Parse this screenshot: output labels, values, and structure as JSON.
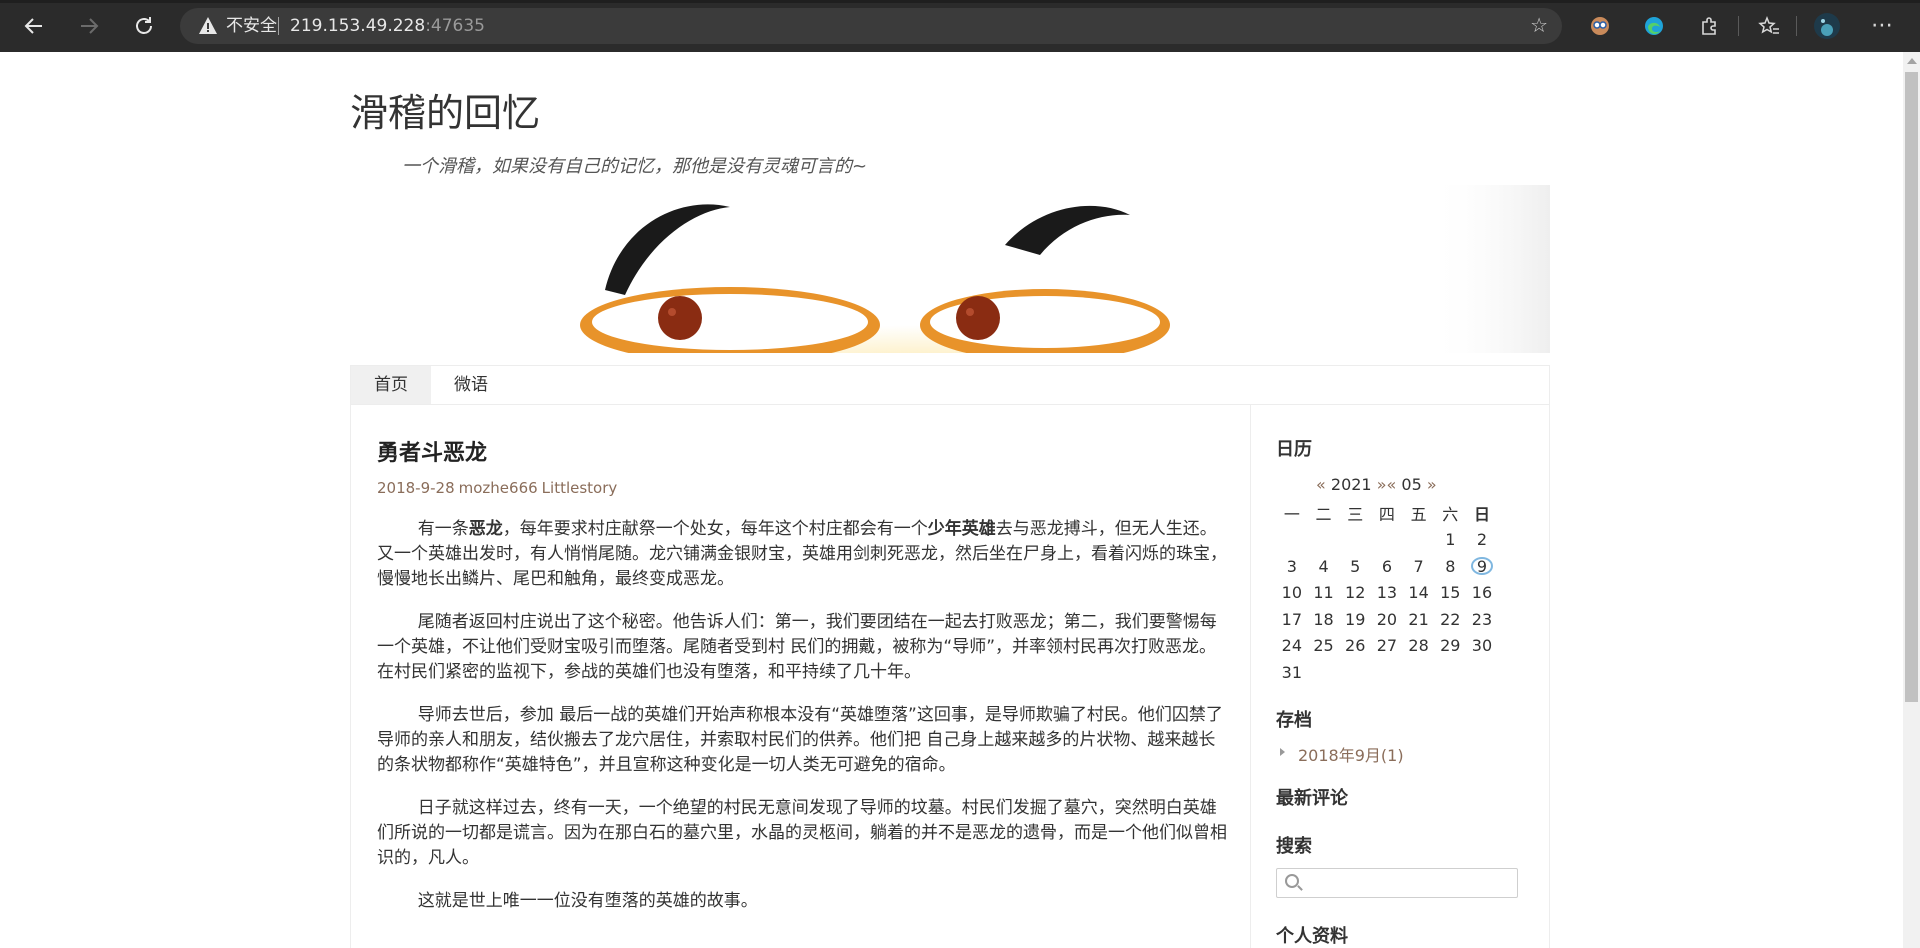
{
  "browser": {
    "back_icon": "arrow-left-icon",
    "forward_icon": "arrow-right-icon",
    "reload_icon": "reload-icon",
    "security_label": "不安全",
    "url_host": "219.153.49.228",
    "url_port": ":47635",
    "more_label": "⋯"
  },
  "site": {
    "title": "滑稽的回忆",
    "description": "一个滑稽，如果没有自己的记忆，那他是没有灵魂可言的~"
  },
  "menu": {
    "items": [
      "首页",
      "微语"
    ],
    "active": "首页"
  },
  "post": {
    "title": "勇者斗恶龙",
    "date": "2018-9-28",
    "author": "mozhe666",
    "category": "Littlestory",
    "p1_a": "有一条",
    "p1_b": "恶龙",
    "p1_c": "，每年要求村庄献祭一个处女，每年这个村庄都会有一个",
    "p1_d": "少年英雄",
    "p1_e": "去与恶龙搏斗，但无人生还。又一个英雄出发时，有人悄悄尾随。龙穴铺满金银财宝，英雄用剑刺死恶龙，然后坐在尸身上，看着闪烁的珠宝，慢慢地长出鳞片、尾巴和触角，最终变成恶龙。",
    "p2": "尾随者返回村庄说出了这个秘密。他告诉人们：第一，我们要团结在一起去打败恶龙；第二，我们要警惕每一个英雄，不让他们受财宝吸引而堕落。尾随者受到村 民们的拥戴，被称为“导师”，并率领村民再次打败恶龙。在村民们紧密的监视下，参战的英雄们也没有堕落，和平持续了几十年。",
    "p3": "导师去世后，参加 最后一战的英雄们开始声称根本没有“英雄堕落”这回事，是导师欺骗了村民。他们囚禁了导师的亲人和朋友，结伙搬去了龙穴居住，并索取村民们的供养。他们把 自己身上越来越多的片状物、越来越长的条状物都称作“英雄特色”，并且宣称这种变化是一切人类无可避免的宿命。",
    "p4": "日子就这样过去，终有一天，一个绝望的村民无意间发现了导师的坟墓。村民们发掘了墓穴，突然明白英雄们所说的一切都是谎言。因为在那白石的墓穴里，水晶的灵柩间，躺着的并不是恶龙的遗骨，而是一个他们似曾相识的，凡人。",
    "p5": "这就是世上唯一一位没有堕落的英雄的故事。"
  },
  "sidebar": {
    "calendar_title": "日历",
    "cal_prev": "«",
    "cal_year": "2021",
    "cal_next": "»",
    "cal_prev2": "«",
    "cal_month": "05",
    "cal_next2": "»",
    "weekdays": [
      "一",
      "二",
      "三",
      "四",
      "五",
      "六",
      "日"
    ],
    "weeks": [
      [
        "",
        "",
        "",
        "",
        "",
        "1",
        "2"
      ],
      [
        "3",
        "4",
        "5",
        "6",
        "7",
        "8",
        "9"
      ],
      [
        "10",
        "11",
        "12",
        "13",
        "14",
        "15",
        "16"
      ],
      [
        "17",
        "18",
        "19",
        "20",
        "21",
        "22",
        "23"
      ],
      [
        "24",
        "25",
        "26",
        "27",
        "28",
        "29",
        "30"
      ],
      [
        "31",
        "",
        "",
        "",
        "",
        "",
        ""
      ]
    ],
    "today": "9",
    "archive_title": "存档",
    "archive_item": "2018年9月(1)",
    "comments_title": "最新评论",
    "search_title": "搜索",
    "profile_title": "个人资料"
  },
  "colors": {
    "chrome_bg": "#2b2b2b",
    "address_bg": "#3b3b3b",
    "link": "#8a6d5a",
    "today_ring": "#7fb7e0"
  }
}
